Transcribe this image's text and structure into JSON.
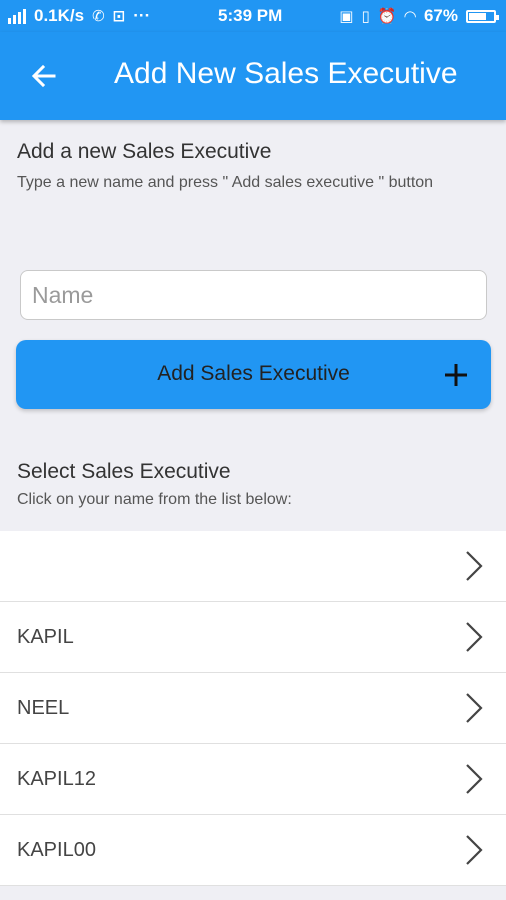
{
  "status_bar": {
    "network_speed": "0.1K/s",
    "time": "5:39 PM",
    "battery": "67%",
    "more_indicator": "···"
  },
  "app_bar": {
    "title": "Add New Sales Executive",
    "back_icon": "arrow-left-icon"
  },
  "add_section": {
    "heading": "Add a new Sales Executive",
    "instruction": "Type a new name and press \" Add sales executive \" button",
    "name_input": {
      "value": "",
      "placeholder": "Name"
    },
    "add_button_label": "Add Sales Executive",
    "add_icon": "plus-icon"
  },
  "select_section": {
    "heading": "Select Sales Executive",
    "instruction": "Click on your name from the list below:"
  },
  "executives": [
    {
      "label": ""
    },
    {
      "label": "KAPIL"
    },
    {
      "label": "NEEL"
    },
    {
      "label": "KAPIL12"
    },
    {
      "label": "KAPIL00"
    }
  ],
  "colors": {
    "primary": "#2196f3",
    "background": "#efeff4"
  }
}
